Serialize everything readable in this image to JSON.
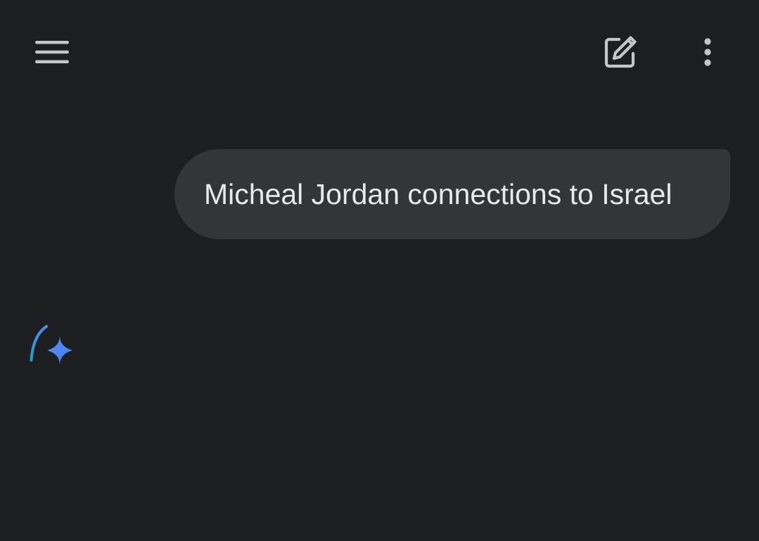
{
  "header": {
    "menu_icon": "hamburger-menu-icon",
    "new_chat_icon": "edit-square-icon",
    "more_icon": "more-vertical-icon"
  },
  "conversation": {
    "user_message": "Micheal Jordan connections to Israel",
    "assistant_status_icon": "sparkle-loading-icon"
  },
  "colors": {
    "background": "#1d1e20",
    "bubble": "#343538",
    "text": "#e8e9ec",
    "icon": "#c4c7c5",
    "sparkle_blue": "#4c8df6",
    "arc_teal": "#1aa3c7"
  }
}
